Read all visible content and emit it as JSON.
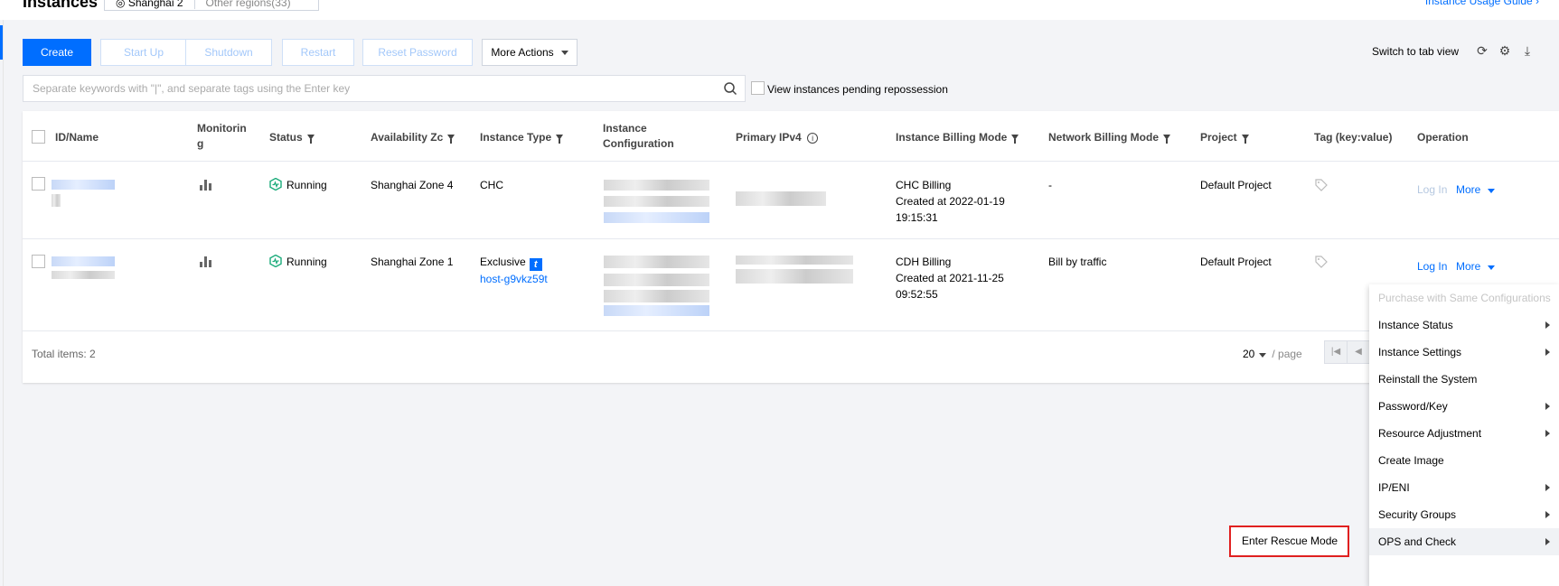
{
  "header": {
    "title": "Instances",
    "region_active": "Shanghai 2",
    "region_other": "Other regions(33)",
    "guide_link": "Instance Usage Guide ›"
  },
  "toolbar": {
    "create": "Create",
    "start_up": "Start Up",
    "shutdown": "Shutdown",
    "restart": "Restart",
    "reset_password": "Reset Password",
    "more_actions": "More Actions",
    "switch_view": "Switch to tab view"
  },
  "search": {
    "placeholder": "Separate keywords with \"|\", and separate tags using the Enter key",
    "pending_label": "View instances pending repossession"
  },
  "table": {
    "headers": {
      "id_name": "ID/Name",
      "monitoring_1": "Monitorin",
      "monitoring_2": "g",
      "status": "Status",
      "az": "Availability Zc",
      "instance_type": "Instance Type",
      "config_1": "Instance",
      "config_2": "Configuration",
      "ipv4": "Primary IPv4",
      "billing_mode": "Instance Billing Mode",
      "network_billing": "Network Billing Mode",
      "project": "Project",
      "tag": "Tag (key:value)",
      "operation": "Operation"
    },
    "rows": [
      {
        "status": "Running",
        "az": "Shanghai Zone 4",
        "instance_type": "CHC",
        "billing_1": "CHC Billing",
        "billing_2": "Created at 2022-01-19",
        "billing_3": "19:15:31",
        "network_billing": "-",
        "project": "Default Project",
        "op_login": "Log In",
        "op_more": "More"
      },
      {
        "status": "Running",
        "az": "Shanghai Zone 1",
        "instance_type": "Exclusive",
        "host_link": "host-g9vkz59t",
        "billing_1": "CDH Billing",
        "billing_2": "Created at 2021-11-25",
        "billing_3": "09:52:55",
        "network_billing": "Bill by traffic",
        "project": "Default Project",
        "op_login": "Log In",
        "op_more": "More"
      }
    ],
    "total": "Total items:  2",
    "page_size": "20",
    "page_unit": "/ page"
  },
  "menu": {
    "items": [
      "Purchase with Same Configurations",
      "Instance Status",
      "Instance Settings",
      "Reinstall the System",
      "Password/Key",
      "Resource Adjustment",
      "Create Image",
      "IP/ENI",
      "Security Groups",
      "OPS and Check"
    ],
    "submenu_item": "Enter Rescue Mode"
  },
  "colors": {
    "accent": "#006eff",
    "highlight_border": "#e02020",
    "running": "#1aab7a"
  }
}
